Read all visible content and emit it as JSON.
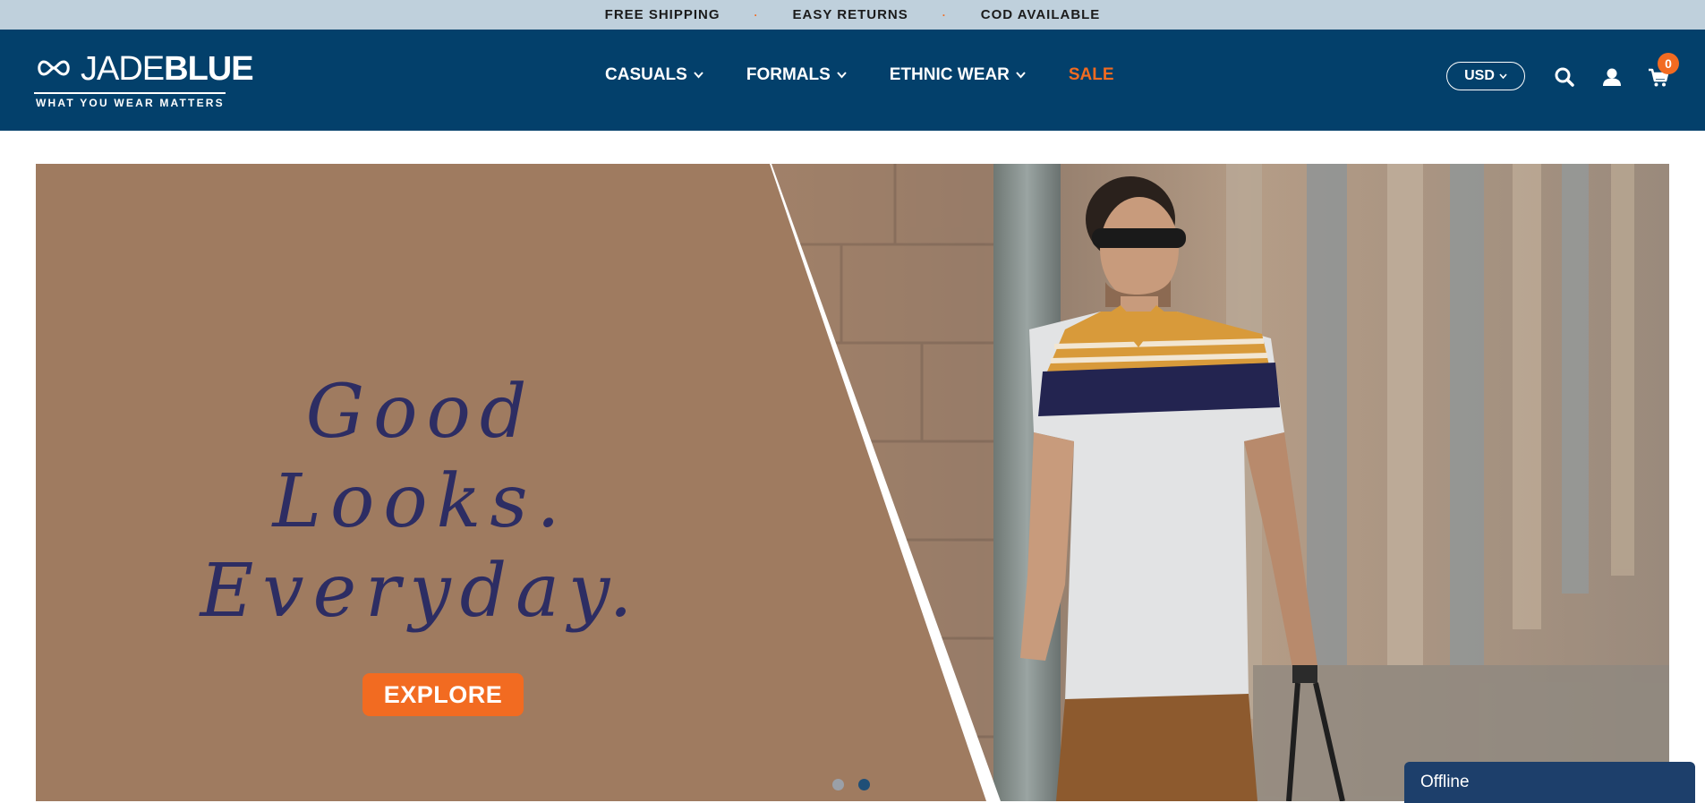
{
  "announcement": {
    "items": [
      "FREE SHIPPING",
      "EASY RETURNS",
      "COD AVAILABLE"
    ],
    "separator": "·"
  },
  "logo": {
    "brand_thin": "JADE",
    "brand_bold": "BLUE",
    "tagline": "WHAT YOU WEAR MATTERS"
  },
  "nav": {
    "items": [
      {
        "label": "CASUALS",
        "dropdown": true
      },
      {
        "label": "FORMALS",
        "dropdown": true
      },
      {
        "label": "ETHNIC WEAR",
        "dropdown": true
      },
      {
        "label": "SALE",
        "dropdown": false
      }
    ]
  },
  "currency": {
    "selected": "USD"
  },
  "cart": {
    "count": "0"
  },
  "hero": {
    "headline_line1": "Good Looks.",
    "headline_line2": "Everyday.",
    "cta_label": "EXPLORE",
    "slide_count": 2,
    "active_slide": 2
  },
  "chat": {
    "status": "Offline"
  },
  "colors": {
    "announcement_bg": "#bfd0dc",
    "header_bg": "#03406b",
    "accent": "#f26b21",
    "hero_panel": "#9f7b60",
    "headline_text": "#2d2d63",
    "chat_bg": "#1d3f6b"
  }
}
